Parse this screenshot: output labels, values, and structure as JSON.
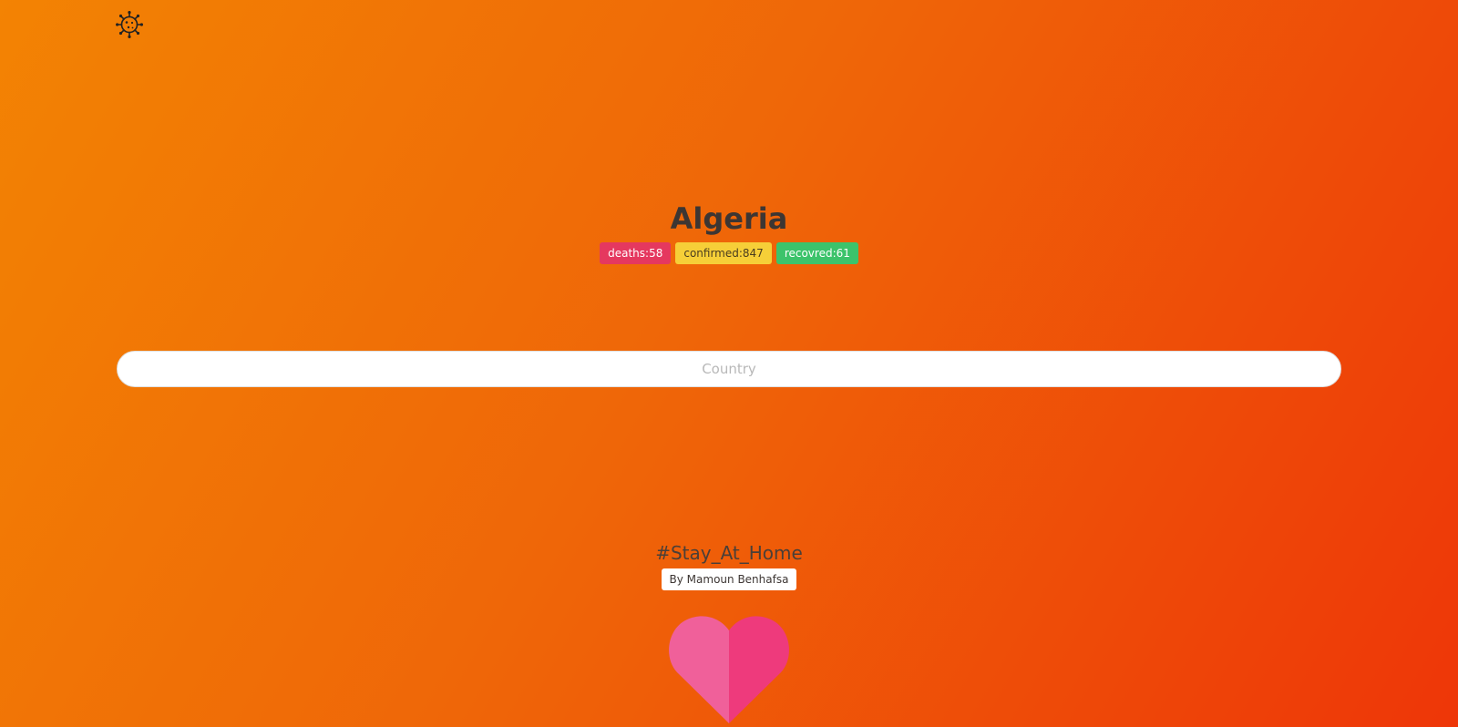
{
  "header": {
    "logo_icon": "virus-icon"
  },
  "country": {
    "name": "Algeria",
    "stats": {
      "deaths": "deaths:58",
      "confirmed": "confirmed:847",
      "recovered": "recovred:61"
    }
  },
  "search": {
    "placeholder": "Country",
    "value": ""
  },
  "footer": {
    "hashtag": "#Stay_At_Home",
    "author": "By Mamoun Benhafsa",
    "heart_icon": "heart-icon"
  },
  "colors": {
    "background_start": "#f38303",
    "background_end": "#ee3608",
    "deaths": "#e5385f",
    "confirmed": "#f6cf38",
    "recovered": "#3cc36b",
    "heart_left": "#f0609a",
    "heart_right": "#ee3a7c"
  }
}
